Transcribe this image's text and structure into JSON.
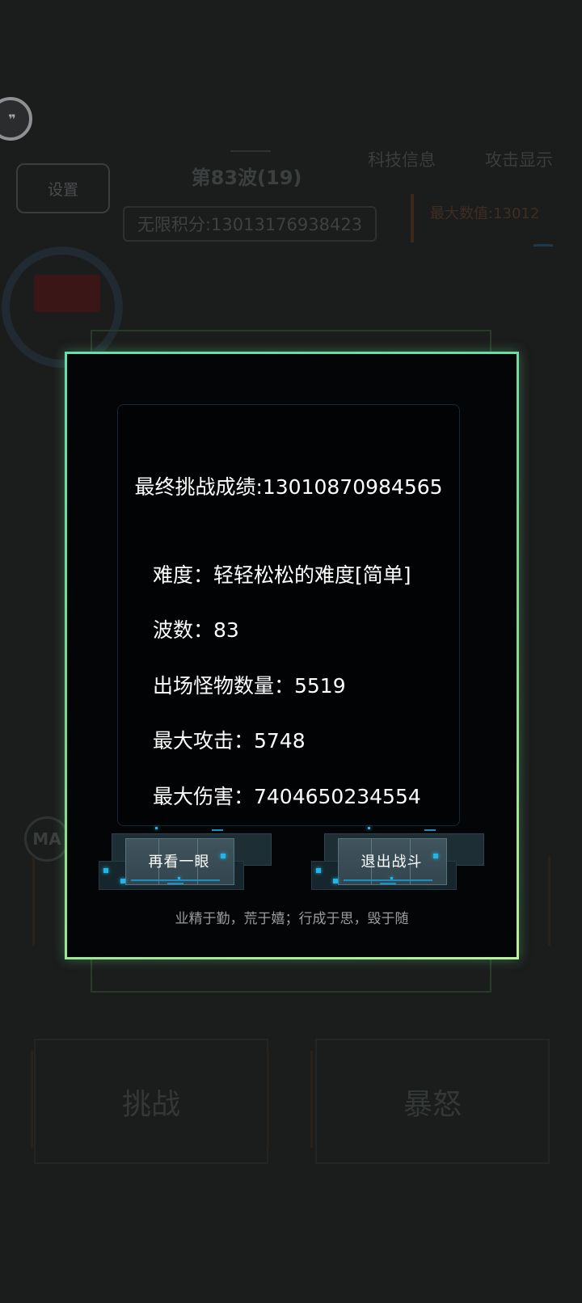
{
  "background": {
    "chat_icon_glyph": "❞",
    "settings_label": "设置",
    "wave_label": "第83波(19)",
    "infinite_score": "无限积分:13013176938423",
    "tech_info_label": "科技信息",
    "attack_display_label": "攻击显示",
    "top_right_info": "最大数值:13012",
    "ma_badge": "MA",
    "challenge_label": "挑战",
    "rage_label": "暴怒"
  },
  "modal": {
    "final_score": "最终挑战成绩:13010870984565",
    "stats": {
      "difficulty": "难度：轻轻松松的难度[简单]",
      "waves": "波数：83",
      "monster_count": "出场怪物数量：5519",
      "max_attack": "最大攻击：5748",
      "max_damage": "最大伤害：7404650234554"
    },
    "buttons": {
      "look_again": "再看一眼",
      "exit_battle": "退出战斗"
    },
    "motto": "业精于勤，荒于嬉；行成于思，毁于随"
  },
  "colors": {
    "background": "#1b1c1c",
    "modal_background": "#040506",
    "modal_border": "#7ad98a",
    "accent_cyan": "#1fb6ea",
    "text": "#ffffff",
    "motto_text": "#9a9c9d"
  }
}
